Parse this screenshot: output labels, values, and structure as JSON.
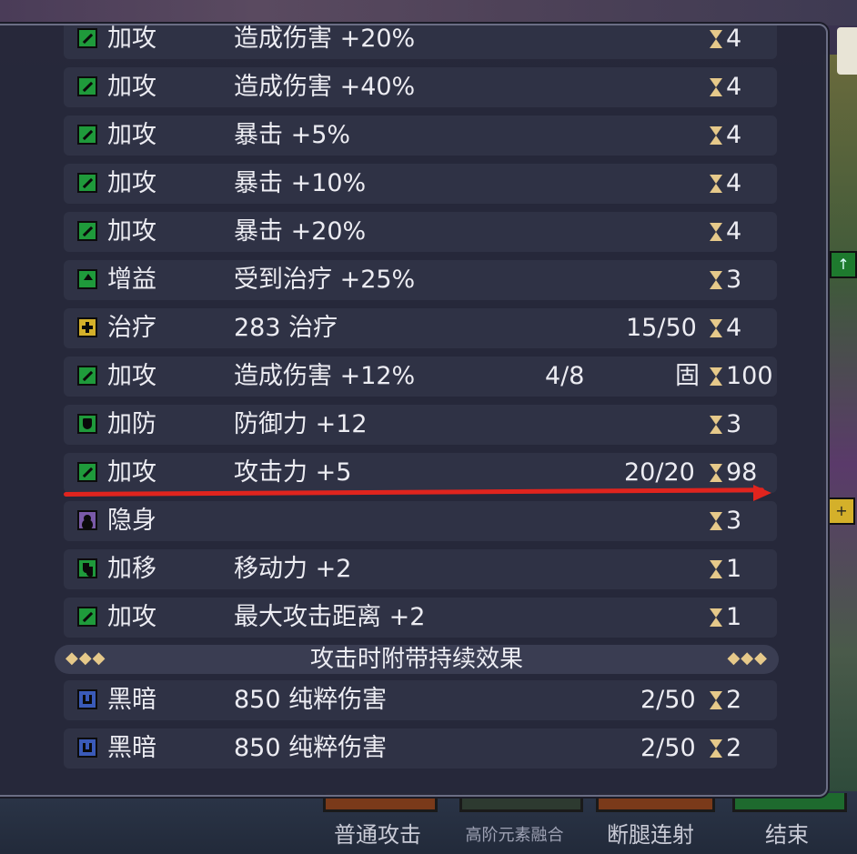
{
  "buff_rows": [
    {
      "icon": "attack-up-icon",
      "type": "加攻",
      "effect": "造成伤害 +20%",
      "extra": "",
      "value": "",
      "duration": "4"
    },
    {
      "icon": "attack-up-icon",
      "type": "加攻",
      "effect": "造成伤害 +40%",
      "extra": "",
      "value": "",
      "duration": "4"
    },
    {
      "icon": "attack-up-icon",
      "type": "加攻",
      "effect": "暴击 +5%",
      "extra": "",
      "value": "",
      "duration": "4"
    },
    {
      "icon": "attack-up-icon",
      "type": "加攻",
      "effect": "暴击 +10%",
      "extra": "",
      "value": "",
      "duration": "4"
    },
    {
      "icon": "attack-up-icon",
      "type": "加攻",
      "effect": "暴击 +20%",
      "extra": "",
      "value": "",
      "duration": "4"
    },
    {
      "icon": "buff-up-icon",
      "type": "增益",
      "effect": "受到治疗 +25%",
      "extra": "",
      "value": "",
      "duration": "3"
    },
    {
      "icon": "heal-icon",
      "type": "治疗",
      "effect": "283 治疗",
      "extra": "",
      "value": "15/50",
      "duration": "4"
    },
    {
      "icon": "attack-up-icon",
      "type": "加攻",
      "effect": "造成伤害 +12%",
      "extra": "4/8",
      "value": "固",
      "duration": "100"
    },
    {
      "icon": "shield-icon",
      "type": "加防",
      "effect": "防御力 +12",
      "extra": "",
      "value": "",
      "duration": "3"
    },
    {
      "icon": "attack-up-icon",
      "type": "加攻",
      "effect": "攻击力 +5",
      "extra": "",
      "value": "20/20",
      "duration": "98"
    },
    {
      "icon": "stealth-icon",
      "type": "隐身",
      "effect": "",
      "extra": "",
      "value": "",
      "duration": "3"
    },
    {
      "icon": "boot-icon",
      "type": "加移",
      "effect": "移动力 +2",
      "extra": "",
      "value": "",
      "duration": "1"
    },
    {
      "icon": "attack-up-icon",
      "type": "加攻",
      "effect": "最大攻击距离 +2",
      "extra": "",
      "value": "",
      "duration": "1"
    }
  ],
  "on_attack_section": {
    "title": "攻击时附带持续效果",
    "dots_left": "◆◆◆",
    "dots_right": "◆◆◆"
  },
  "on_attack_rows": [
    {
      "icon": "dark-claw-icon",
      "type": "黑暗",
      "effect": "850 纯粹伤害",
      "extra": "",
      "value": "2/50",
      "duration": "2"
    },
    {
      "icon": "dark-claw-icon",
      "type": "黑暗",
      "effect": "850 纯粹伤害",
      "extra": "",
      "value": "2/50",
      "duration": "2"
    }
  ],
  "skills": [
    {
      "label": "普通攻击"
    },
    {
      "label": "高阶元素融合"
    },
    {
      "label": "断腿连射"
    },
    {
      "label": "结束"
    }
  ],
  "colors": {
    "attack_icon": "#1f9a3b",
    "heal_icon": "#d4b02a",
    "stealth_icon": "#7a5aa8",
    "dark_icon": "#3a5ab8",
    "hourglass": "#e6c98a",
    "annotation_arrow": "#e0241e"
  }
}
